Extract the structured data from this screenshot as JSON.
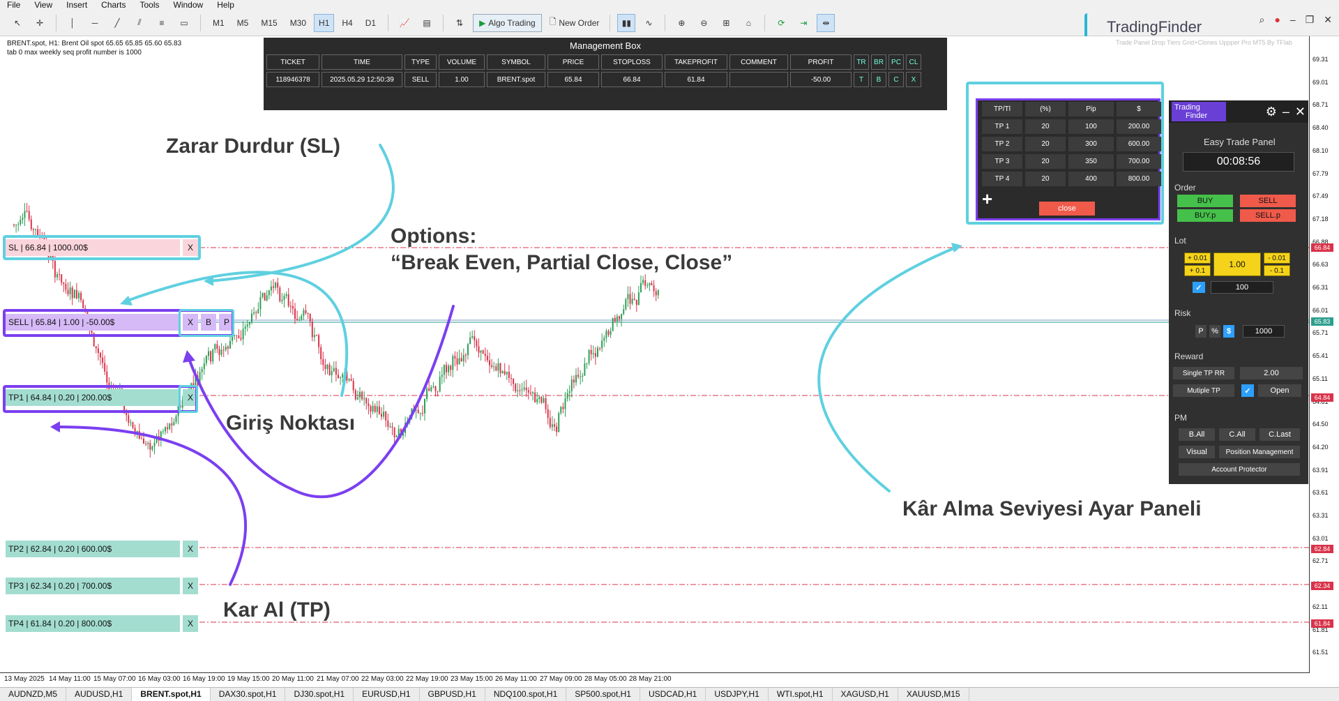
{
  "menu": [
    "File",
    "View",
    "Insert",
    "Charts",
    "Tools",
    "Window",
    "Help"
  ],
  "toolbar": {
    "timeframes": [
      "M1",
      "M5",
      "M15",
      "M30",
      "H1",
      "H4",
      "D1"
    ],
    "active_timeframe": "H1",
    "algo_trading": "Algo Trading",
    "new_order": "New Order"
  },
  "brand": {
    "name": "TradingFinder",
    "faint": "Trade Panel Drop Tiers Grid+Clones Uppper Pro MT5 By TFlab"
  },
  "symbol_info": {
    "line1": "BRENT.spot, H1:  Brent Oil spot  65.65 65.85 65.60 65.83",
    "line2": "tab 0 max weekly seq profit number is 1000"
  },
  "management_box": {
    "title": "Management Box",
    "headers": [
      "TICKET",
      "TIME",
      "TYPE",
      "VOLUME",
      "SYMBOL",
      "PRICE",
      "STOPLOSS",
      "TAKEPROFIT",
      "COMMENT",
      "PROFIT"
    ],
    "header_buttons": [
      "TR",
      "BR",
      "PC",
      "CL"
    ],
    "row": [
      "118946378",
      "2025.05.29 12:50:39",
      "SELL",
      "1.00",
      "BRENT.spot",
      "65.84",
      "66.84",
      "61.84",
      "",
      "-50.00"
    ],
    "row_buttons": [
      "T",
      "B",
      "C",
      "X"
    ]
  },
  "levels": {
    "sl": "SL | 66.84 | 1000.00$",
    "sell": "SELL | 65.84 | 1.00 | -50.00$",
    "tp1": "TP1 | 64.84 | 0.20 | 200.00$",
    "tp2": "TP2 | 62.84 | 0.20 | 600.00$",
    "tp3": "TP3 | 62.34 | 0.20 | 700.00$",
    "tp4": "TP4 | 61.84 | 0.20 | 800.00$",
    "x": "X",
    "b": "B",
    "p": "P"
  },
  "annotations": {
    "sl": "Zarar Durdur (SL)",
    "options1": "Options:",
    "options2": "“Break Even, Partial Close, Close”",
    "entry": "Giriş Noktası",
    "tp": "Kar Al (TP)",
    "panel": "Kâr Alma Seviyesi Ayar Paneli"
  },
  "tp_table": {
    "headers": [
      "TP/Tl",
      "(%)",
      "Pip",
      "$"
    ],
    "rows": [
      [
        "TP 1",
        "20",
        "100",
        "200.00"
      ],
      [
        "TP 2",
        "20",
        "300",
        "600.00"
      ],
      [
        "TP 3",
        "20",
        "350",
        "700.00"
      ],
      [
        "TP 4",
        "20",
        "400",
        "800.00"
      ]
    ],
    "close": "close",
    "plus": "+"
  },
  "panel": {
    "logo1": "Trading",
    "logo2": "Finder",
    "title": "Easy Trade Panel",
    "timer": "00:08:56",
    "order": "Order",
    "buy": "BUY",
    "sell": "SELL",
    "buyp": "BUY.p",
    "sellp": "SELL.p",
    "lot": "Lot",
    "p001": "+ 0.01",
    "p01": "+ 0.1",
    "lot_value": "1.00",
    "m001": "- 0.01",
    "m01": "- 0.1",
    "lot_step": "100",
    "risk": "Risk",
    "risk_p": "P",
    "risk_pct": "%",
    "risk_usd": "$",
    "risk_value": "1000",
    "reward": "Reward",
    "single_tp": "Single TP RR",
    "rr_value": "2.00",
    "multiple_tp": "Mutiple TP",
    "open": "Open",
    "pm": "PM",
    "ball": "B.All",
    "call": "C.All",
    "clast": "C.Last",
    "visual": "Visual",
    "position_mgmt": "Position Management",
    "account_protector": "Account Protector"
  },
  "price_axis": [
    "69.31",
    "69.01",
    "68.71",
    "68.40",
    "68.10",
    "67.79",
    "67.49",
    "67.18",
    "66.88",
    "66.63",
    "66.31",
    "66.01",
    "65.71",
    "65.41",
    "65.11",
    "64.81",
    "64.50",
    "64.20",
    "63.91",
    "63.61",
    "63.31",
    "63.01",
    "62.71",
    "62.41",
    "62.11",
    "61.81",
    "61.51"
  ],
  "price_tags": {
    "sl": "66.84",
    "cur": "65.83",
    "tp1": "64.84",
    "tp2": "62.84",
    "tp3": "62.34",
    "tp4": "61.84"
  },
  "time_axis": [
    "13 May 2025",
    "14 May 11:00",
    "15 May 07:00",
    "16 May 03:00",
    "16 May 19:00",
    "19 May 15:00",
    "20 May 11:00",
    "21 May 07:00",
    "22 May 03:00",
    "22 May 19:00",
    "23 May 15:00",
    "26 May 11:00",
    "27 May 09:00",
    "28 May 05:00",
    "28 May 21:00"
  ],
  "bottom_tabs": [
    "AUDNZD,M5",
    "AUDUSD,H1",
    "BRENT.spot,H1",
    "DAX30.spot,H1",
    "DJ30.spot,H1",
    "EURUSD,H1",
    "GBPUSD,H1",
    "NDQ100.spot,H1",
    "SP500.spot,H1",
    "USDCAD,H1",
    "USDJPY,H1",
    "WTI.spot,H1",
    "XAGUSD,H1",
    "XAUUSD,M15"
  ],
  "active_tab": "BRENT.spot,H1",
  "colors": {
    "sl_bg": "#fbd5dc",
    "sell_bg": "#d6b9f7",
    "tp_bg": "#a3ddd0",
    "dash": "#d9334a",
    "annot_cyan": "#5fd0e0",
    "annot_purple": "#7b3ff0",
    "bull": "#2e9e56",
    "bear": "#d9334a"
  }
}
